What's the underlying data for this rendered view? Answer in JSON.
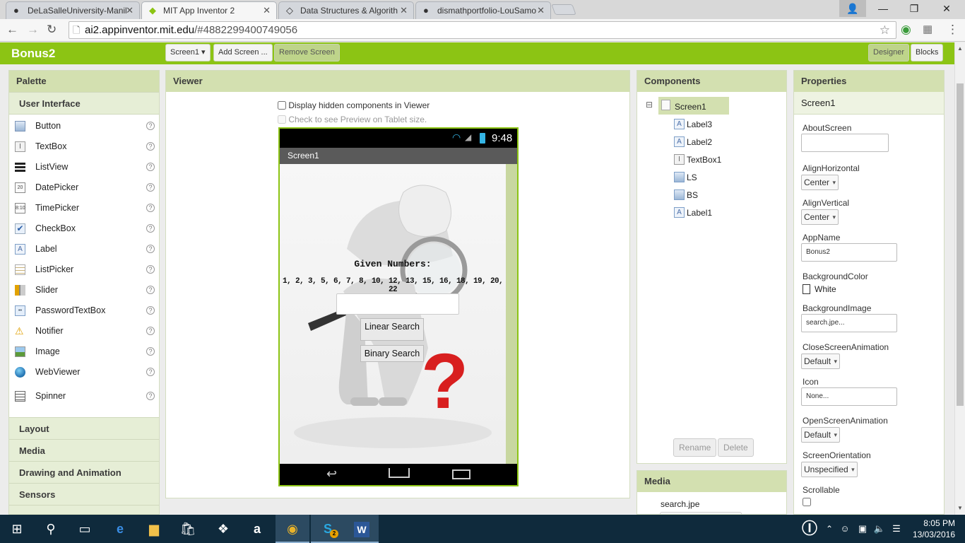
{
  "browser": {
    "tabs": [
      {
        "title": "DeLaSalleUniversity-Manil",
        "icon": "github-icon"
      },
      {
        "title": "MIT App Inventor 2",
        "icon": "app-inventor-icon"
      },
      {
        "title": "Data Structures & Algorith",
        "icon": "diamond-icon"
      },
      {
        "title": "dismathportfolio-LouSamo",
        "icon": "github-icon"
      }
    ],
    "active_tab": 1,
    "url_host": "ai2.appinventor.mit.edu",
    "url_rest": "/#4882299400749056"
  },
  "header": {
    "app_name": "Bonus2",
    "screen_select": "Screen1 ▾",
    "add_screen": "Add Screen ...",
    "remove_screen": "Remove Screen",
    "designer": "Designer",
    "blocks": "Blocks",
    "brand_color": "#8cc414"
  },
  "palette": {
    "title": "Palette",
    "category_open": "User Interface",
    "items": [
      {
        "label": "Button",
        "icon": "button-icon"
      },
      {
        "label": "TextBox",
        "icon": "textbox-icon"
      },
      {
        "label": "ListView",
        "icon": "listview-icon"
      },
      {
        "label": "DatePicker",
        "icon": "datepicker-icon"
      },
      {
        "label": "TimePicker",
        "icon": "timepicker-icon"
      },
      {
        "label": "CheckBox",
        "icon": "checkbox-icon"
      },
      {
        "label": "Label",
        "icon": "label-icon"
      },
      {
        "label": "ListPicker",
        "icon": "listpicker-icon"
      },
      {
        "label": "Slider",
        "icon": "slider-icon"
      },
      {
        "label": "PasswordTextBox",
        "icon": "password-icon"
      },
      {
        "label": "Notifier",
        "icon": "notifier-icon"
      },
      {
        "label": "Image",
        "icon": "image-icon"
      },
      {
        "label": "WebViewer",
        "icon": "webviewer-icon"
      },
      {
        "label": "Spinner",
        "icon": "spinner-icon"
      }
    ],
    "help_glyph": "?",
    "categories": [
      "Layout",
      "Media",
      "Drawing and Animation",
      "Sensors"
    ]
  },
  "viewer": {
    "title": "Viewer",
    "hidden_components": "Display hidden components in Viewer",
    "tablet_preview": "Check to see Preview on Tablet size.",
    "phone": {
      "time": "9:48",
      "screen_title": "Screen1",
      "given_label": "Given Numbers:",
      "numbers": "1, 2, 3, 5, 6, 7, 8, 10, 12, 13, 15, 16, 18, 19, 20, 22",
      "textbox_value": "",
      "linear_button": "Linear Search",
      "binary_button": "Binary Search"
    }
  },
  "components": {
    "title": "Components",
    "root": "Screen1",
    "collapse_glyph": "⊟",
    "children": [
      {
        "label": "Label3",
        "icon": "label-icon",
        "glyph": "A"
      },
      {
        "label": "Label2",
        "icon": "label-icon",
        "glyph": "A"
      },
      {
        "label": "TextBox1",
        "icon": "textbox-icon",
        "glyph": "I"
      },
      {
        "label": "LS",
        "icon": "button-icon",
        "glyph": ""
      },
      {
        "label": "BS",
        "icon": "button-icon",
        "glyph": ""
      },
      {
        "label": "Label1",
        "icon": "label-icon",
        "glyph": "A"
      }
    ],
    "rename": "Rename",
    "delete": "Delete"
  },
  "media": {
    "title": "Media",
    "files": [
      "search.jpe"
    ]
  },
  "properties": {
    "title": "Properties",
    "component": "Screen1",
    "about_label": "AboutScreen",
    "about_value": "",
    "align_h_label": "AlignHorizontal",
    "align_h_value": "Center",
    "align_v_label": "AlignVertical",
    "align_v_value": "Center",
    "appname_label": "AppName",
    "appname_value": "Bonus2",
    "bgcolor_label": "BackgroundColor",
    "bgcolor_value": "White",
    "bgimage_label": "BackgroundImage",
    "bgimage_value": "search.jpe...",
    "close_anim_label": "CloseScreenAnimation",
    "close_anim_value": "Default",
    "icon_label": "Icon",
    "icon_value": "None...",
    "open_anim_label": "OpenScreenAnimation",
    "open_anim_value": "Default",
    "orientation_label": "ScreenOrientation",
    "orientation_value": "Unspecified",
    "scrollable_label": "Scrollable"
  },
  "taskbar": {
    "time": "8:05 PM",
    "date": "13/03/2016",
    "skype_badge": "2"
  }
}
